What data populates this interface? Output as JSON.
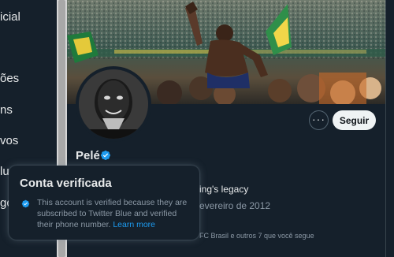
{
  "left_nav": {
    "items": [
      {
        "label": "icial"
      },
      {
        "label": "ões"
      },
      {
        "label": "ns"
      },
      {
        "label": "vos"
      },
      {
        "label": "lu"
      },
      {
        "label": "gç"
      }
    ]
  },
  "profile": {
    "name": "Pelé",
    "follow_label": "Seguir",
    "more_label": "···",
    "bio_fragment": "ing's legacy",
    "joined_fragment": "evereiro de 2012",
    "followed_by_fragment": "FC Brasil e outros 7 que você segue"
  },
  "tooltip": {
    "title": "Conta verificada",
    "body": "This account is verified because they are subscribed to Twitter Blue and verified their phone number. ",
    "link": "Learn more"
  },
  "colors": {
    "background": "#15202b",
    "accent": "#1d9bf0",
    "secondary_text": "#8b98a5"
  },
  "icons": {
    "verified": "verified-badge-icon",
    "more": "more-horizontal-icon"
  }
}
